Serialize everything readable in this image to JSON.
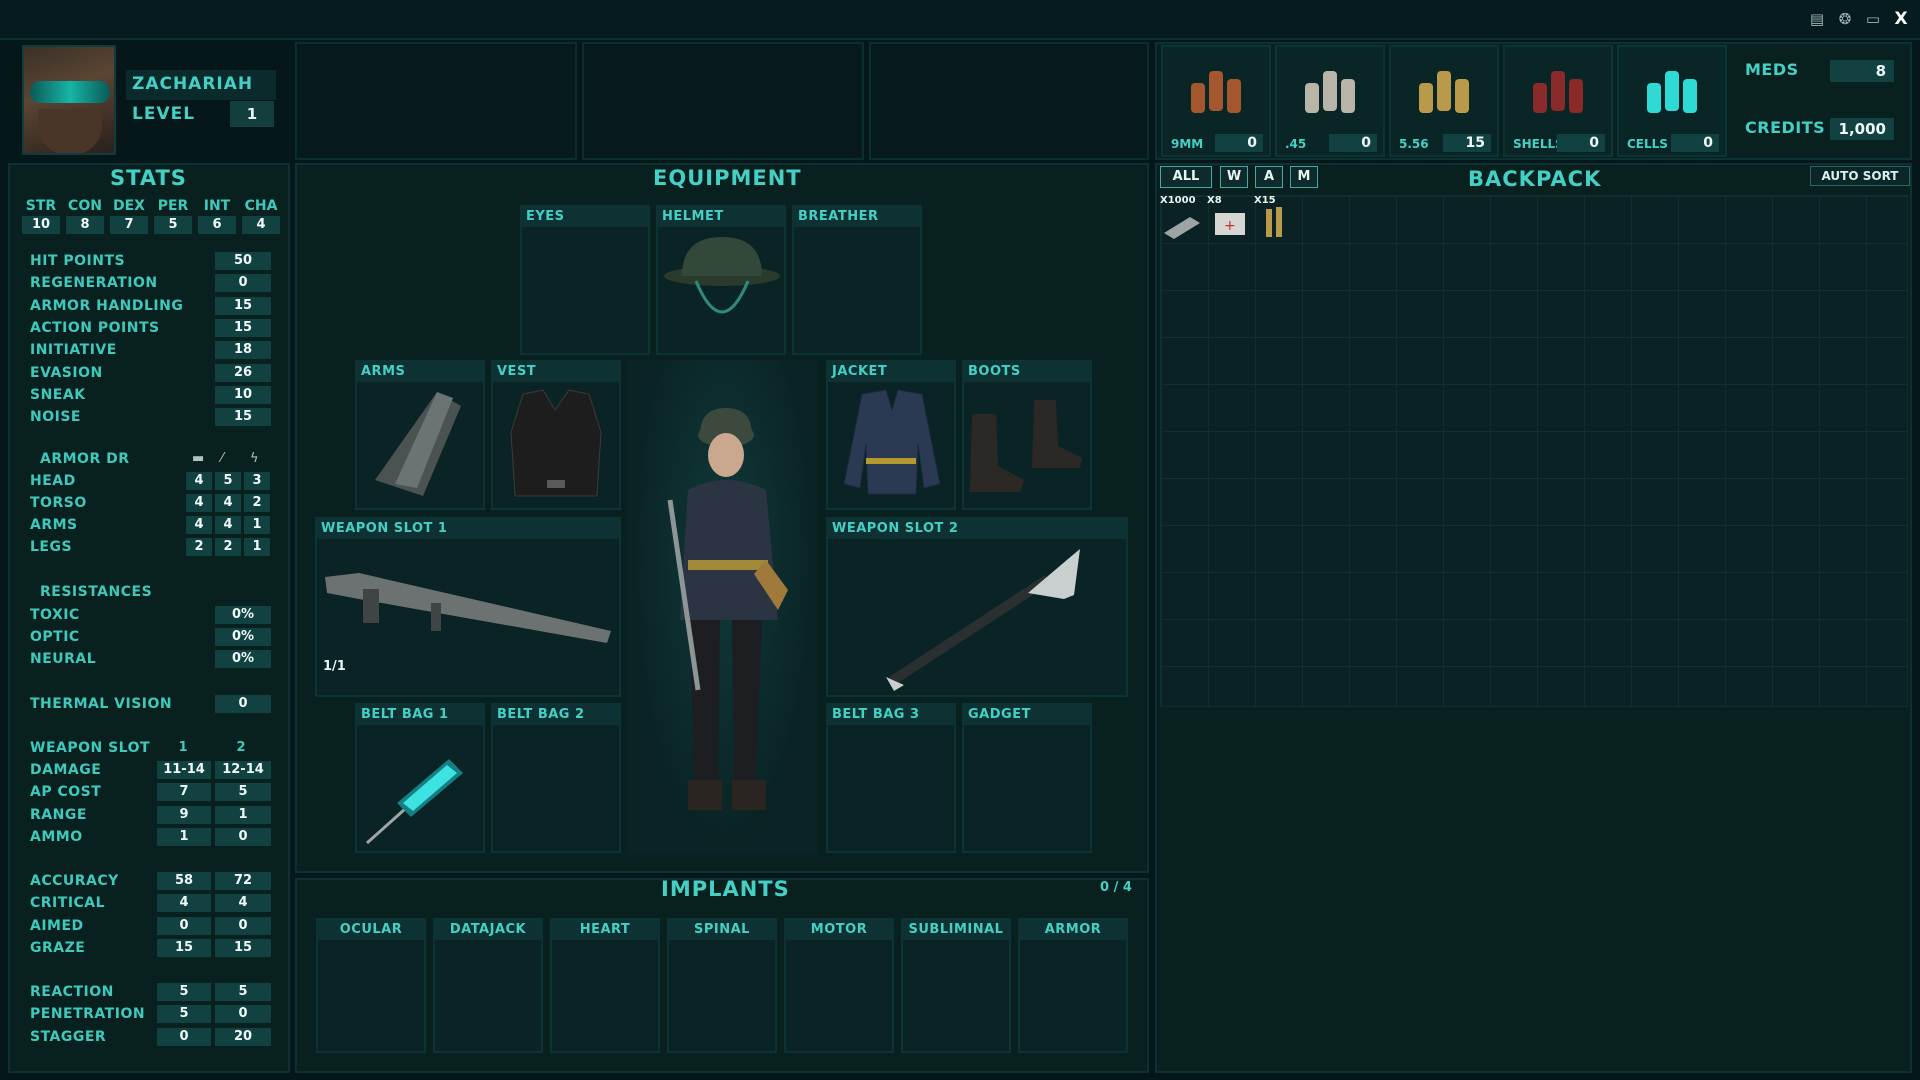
{
  "window": {
    "icons": [
      "notes-icon",
      "brain-icon",
      "monitor-icon",
      "close-icon"
    ]
  },
  "character": {
    "name": "ZACHARIAH",
    "level_label": "LEVEL",
    "level": "1"
  },
  "stats": {
    "title": "STATS",
    "attributes": [
      {
        "abbr": "STR",
        "value": "10"
      },
      {
        "abbr": "CON",
        "value": "8"
      },
      {
        "abbr": "DEX",
        "value": "7"
      },
      {
        "abbr": "PER",
        "value": "5"
      },
      {
        "abbr": "INT",
        "value": "6"
      },
      {
        "abbr": "CHA",
        "value": "4"
      }
    ],
    "derived": [
      {
        "label": "HIT POINTS",
        "value": "50"
      },
      {
        "label": "REGENERATION",
        "value": "0"
      },
      {
        "label": "ARMOR HANDLING",
        "value": "15"
      },
      {
        "label": "ACTION POINTS",
        "value": "15"
      },
      {
        "label": "INITIATIVE",
        "value": "18"
      },
      {
        "label": "EVASION",
        "value": "26"
      },
      {
        "label": "SNEAK",
        "value": "10"
      },
      {
        "label": "NOISE",
        "value": "15"
      }
    ],
    "armor_dr": {
      "title": "ARMOR DR",
      "icons": [
        "bullet-icon",
        "blade-icon",
        "energy-icon"
      ],
      "rows": [
        {
          "label": "HEAD",
          "values": [
            "4",
            "5",
            "3"
          ]
        },
        {
          "label": "TORSO",
          "values": [
            "4",
            "4",
            "2"
          ]
        },
        {
          "label": "ARMS",
          "values": [
            "4",
            "4",
            "1"
          ]
        },
        {
          "label": "LEGS",
          "values": [
            "2",
            "2",
            "1"
          ]
        }
      ]
    },
    "resistances": {
      "title": "RESISTANCES",
      "rows": [
        {
          "label": "TOXIC",
          "value": "0%"
        },
        {
          "label": "OPTIC",
          "value": "0%"
        },
        {
          "label": "NEURAL",
          "value": "0%"
        }
      ]
    },
    "thermal_vision": {
      "label": "THERMAL VISION",
      "value": "0"
    },
    "weapon": {
      "header": {
        "label": "WEAPON SLOT",
        "col1": "1",
        "col2": "2"
      },
      "rows": [
        {
          "label": "DAMAGE",
          "v1": "11-14",
          "v2": "12-14"
        },
        {
          "label": "AP COST",
          "v1": "7",
          "v2": "5"
        },
        {
          "label": "RANGE",
          "v1": "9",
          "v2": "1"
        },
        {
          "label": "AMMO",
          "v1": "1",
          "v2": "0"
        }
      ],
      "combat_rows": [
        {
          "label": "ACCURACY",
          "v1": "58",
          "v2": "72"
        },
        {
          "label": "CRITICAL",
          "v1": "4",
          "v2": "4"
        },
        {
          "label": "AIMED",
          "v1": "0",
          "v2": "0"
        },
        {
          "label": "GRAZE",
          "v1": "15",
          "v2": "15"
        }
      ],
      "extra_rows": [
        {
          "label": "REACTION",
          "v1": "5",
          "v2": "5"
        },
        {
          "label": "PENETRATION",
          "v1": "5",
          "v2": "0"
        },
        {
          "label": "STAGGER",
          "v1": "0",
          "v2": "20"
        }
      ]
    }
  },
  "equipment": {
    "title": "EQUIPMENT",
    "slots": {
      "eyes": "EYES",
      "helmet": "HELMET",
      "breather": "BREATHER",
      "arms": "ARMS",
      "vest": "VEST",
      "jacket": "JACKET",
      "boots": "BOOTS",
      "weapon1": "WEAPON SLOT 1",
      "weapon2": "WEAPON SLOT 2",
      "beltbag1": "BELT BAG 1",
      "beltbag2": "BELT BAG 2",
      "beltbag3": "BELT BAG 3",
      "gadget": "GADGET"
    },
    "weapon1_ammo": "1/1"
  },
  "implants": {
    "title": "IMPLANTS",
    "count": "0 / 4",
    "slots": [
      "OCULAR",
      "DATAJACK",
      "HEART",
      "SPINAL",
      "MOTOR",
      "SUBLIMINAL",
      "ARMOR"
    ]
  },
  "ammo": [
    {
      "label": "9MM",
      "value": "0"
    },
    {
      "label": ".45",
      "value": "0"
    },
    {
      "label": "5.56",
      "value": "15"
    },
    {
      "label": "SHELLS",
      "value": "0"
    },
    {
      "label": "CELLS",
      "value": "0"
    }
  ],
  "resources": {
    "meds_label": "MEDS",
    "meds": "8",
    "credits_label": "CREDITS",
    "credits": "1,000"
  },
  "backpack": {
    "title": "BACKPACK",
    "filters": [
      "ALL",
      "W",
      "A",
      "M"
    ],
    "auto_sort": "AUTO SORT",
    "items": [
      {
        "qty": "X1000",
        "icon": "credit-chip-icon"
      },
      {
        "qty": "X8",
        "icon": "medkit-icon"
      },
      {
        "qty": "X15",
        "icon": "rifle-ammo-icon"
      }
    ]
  }
}
